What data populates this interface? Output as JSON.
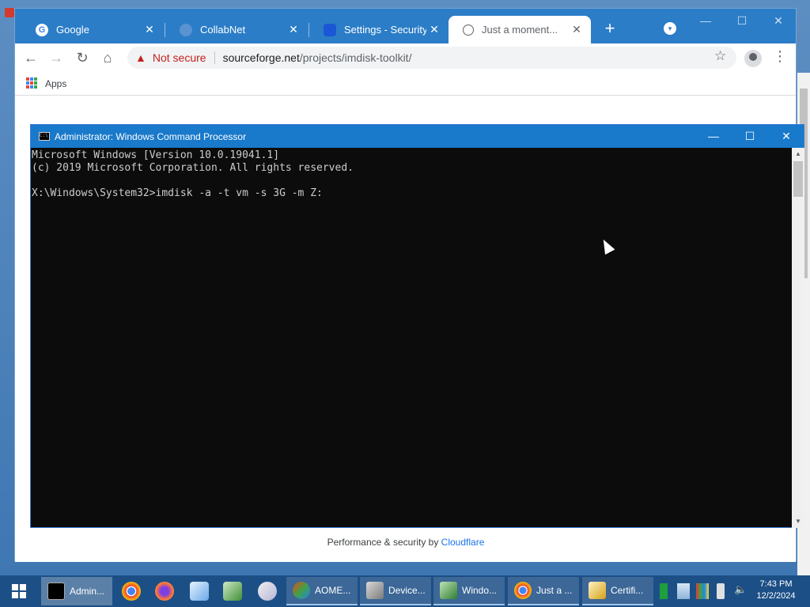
{
  "browser": {
    "tabs": [
      {
        "label": "Google",
        "favicon": "google-g-icon",
        "close": "✕"
      },
      {
        "label": "CollabNet",
        "favicon": "collabnet-icon",
        "close": "✕"
      },
      {
        "label": "Settings - Security",
        "favicon": "settings-icon",
        "close": "✕"
      },
      {
        "label": "Just a moment...",
        "favicon": "globe-icon",
        "close": "✕",
        "active": true
      }
    ],
    "new_tab": "+",
    "window_controls": {
      "minimize": "—",
      "maximize": "☐",
      "close": "✕"
    },
    "nav": {
      "back": "←",
      "forward": "→",
      "reload": "↻",
      "home": "⌂"
    },
    "omnibox": {
      "warning": "▲",
      "security_text": "Not secure",
      "url_host": "sourceforge.net",
      "url_path": "/projects/imdisk-toolkit/"
    },
    "star": "☆",
    "menu": "⋮",
    "bookmarks": {
      "apps_label": "Apps"
    },
    "page": {
      "footer_prefix": "Performance & security by ",
      "footer_link": "Cloudflare"
    }
  },
  "cmd": {
    "title": "Administrator: Windows Command Processor",
    "icon_text": "C:\\",
    "controls": {
      "minimize": "—",
      "maximize": "☐",
      "close": "✕"
    },
    "lines": [
      "Microsoft Windows [Version 10.0.19041.1]",
      "(c) 2019 Microsoft Corporation. All rights reserved.",
      "",
      "X:\\Windows\\System32>imdisk -a -t vm -s 3G -m Z:"
    ],
    "scroll_up": "▲",
    "scroll_down": "▼"
  },
  "taskbar": {
    "tasks": [
      {
        "label": "Admin...",
        "icon": "cmd-icon",
        "state": "active"
      },
      {
        "label": "AOME...",
        "icon": "aomei-icon",
        "state": "open"
      },
      {
        "label": "Device...",
        "icon": "device-manager-icon",
        "state": "open"
      },
      {
        "label": "Windo...",
        "icon": "windows-setup-icon",
        "state": "open"
      },
      {
        "label": "Just a ...",
        "icon": "chrome-icon",
        "state": "open"
      },
      {
        "label": "Certifi...",
        "icon": "certificate-icon",
        "state": "open"
      }
    ],
    "pinned": [
      "chrome-icon",
      "firefox-icon",
      "notepad-icon",
      "registry-icon",
      "paint-icon"
    ],
    "tray": [
      "green-app-icon",
      "network-icon",
      "color-app-icon",
      "usb-icon",
      "volume-muted-icon"
    ],
    "clock": {
      "time": "7:43 PM",
      "date": "12/2/2024"
    }
  },
  "colors": {
    "tab_strip": "#2b7dc7",
    "cmd_titlebar": "#1979ca",
    "taskbar": "#1c4f86",
    "not_secure": "#c5221f",
    "link": "#1a73e8"
  }
}
